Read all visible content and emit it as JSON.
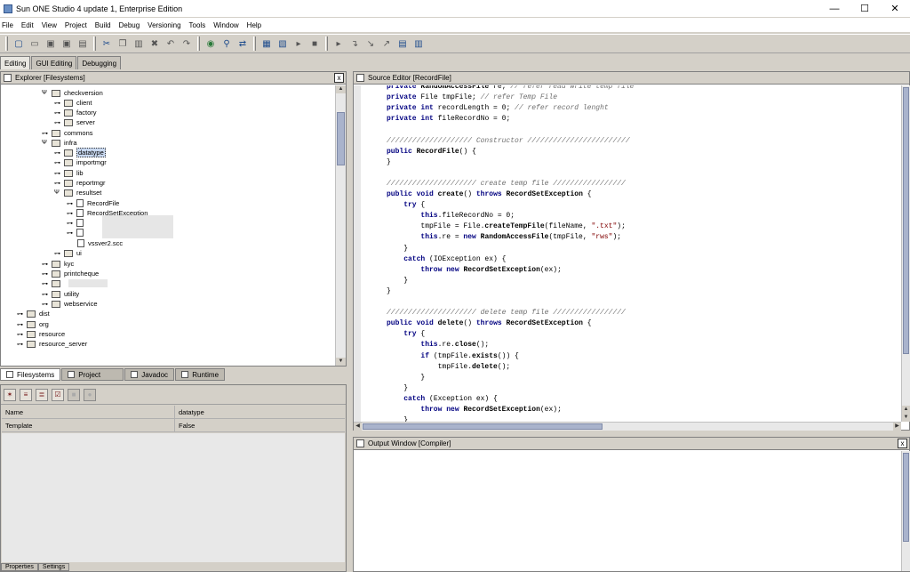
{
  "window": {
    "title": "Sun ONE Studio 4 update 1, Enterprise Edition",
    "minimize": "—",
    "maximize": "☐",
    "close": "✕"
  },
  "menu": [
    "File",
    "Edit",
    "View",
    "Project",
    "Build",
    "Debug",
    "Versioning",
    "Tools",
    "Window",
    "Help"
  ],
  "mode_tabs": [
    "Editing",
    "GUI Editing",
    "Debugging"
  ],
  "explorer": {
    "title": "Explorer [Filesystems]",
    "close": "x",
    "tree": [
      {
        "label": "checkversion",
        "type": "folder",
        "expanded": true
      },
      {
        "label": "client",
        "type": "folder"
      },
      {
        "label": "factory",
        "type": "folder"
      },
      {
        "label": "server",
        "type": "folder"
      },
      {
        "label": "commons",
        "type": "folder"
      },
      {
        "label": "infra",
        "type": "folder",
        "expanded": true
      },
      {
        "label": "datatype",
        "type": "folder",
        "selected": true
      },
      {
        "label": "importmgr",
        "type": "folder"
      },
      {
        "label": "lib",
        "type": "folder"
      },
      {
        "label": "reportmgr",
        "type": "folder"
      },
      {
        "label": "resultset",
        "type": "folder",
        "expanded": true
      },
      {
        "label": "RecordFile",
        "type": "file"
      },
      {
        "label": "RecordSetException",
        "type": "file"
      },
      {
        "label": "",
        "type": "file",
        "redacted": true
      },
      {
        "label": "",
        "type": "file",
        "redacted": true
      },
      {
        "label": "vssver2.scc",
        "type": "file"
      },
      {
        "label": "ui",
        "type": "folder"
      },
      {
        "label": "kyc",
        "type": "folder"
      },
      {
        "label": "printcheque",
        "type": "folder"
      },
      {
        "label": "",
        "type": "folder",
        "redacted": true
      },
      {
        "label": "utility",
        "type": "folder"
      },
      {
        "label": "webservice",
        "type": "folder"
      },
      {
        "label": "dist",
        "type": "folder"
      },
      {
        "label": "org",
        "type": "folder"
      },
      {
        "label": "resource",
        "type": "folder"
      },
      {
        "label": "resource_server",
        "type": "folder"
      }
    ],
    "tabs": [
      "Filesystems",
      "Project",
      "Javadoc",
      "Runtime"
    ]
  },
  "properties": {
    "rows": [
      {
        "name": "Name",
        "value": "datatype"
      },
      {
        "name": "Template",
        "value": "False"
      }
    ],
    "bottom_tabs": [
      "Properties",
      "Settings"
    ]
  },
  "editor": {
    "title": "Source Editor [RecordFile]",
    "code": [
      "private RandomAccessFile re; // refer read write temp file",
      "private File tmpFile; // refer Temp File",
      "private int recordLength = 0; // refer record lenght",
      "private int fileRecordNo = 0;",
      "",
      "//////////////////// Constructor ////////////////////////",
      "public RecordFile() {",
      "}",
      "",
      "///////////////////// create temp file /////////////////",
      "public void create() throws RecordSetException {",
      "    try {",
      "        this.fileRecordNo = 0;",
      "        tmpFile = File.createTempFile(fileName, \".txt\");",
      "        this.re = new RandomAccessFile(tmpFile, \"rws\");",
      "    }",
      "    catch (IOException ex) {",
      "        throw new RecordSetException(ex);",
      "    }",
      "}",
      "",
      "///////////////////// delete temp file /////////////////",
      "public void delete() throws RecordSetException {",
      "    try {",
      "        this.re.close();",
      "        if (tmpFile.exists()) {",
      "            tmpFile.delete();",
      "        }",
      "    }",
      "    catch (Exception ex) {",
      "        throw new RecordSetException(ex);",
      "    }"
    ]
  },
  "output": {
    "title": "Output Window [Compiler]",
    "close": "x"
  }
}
